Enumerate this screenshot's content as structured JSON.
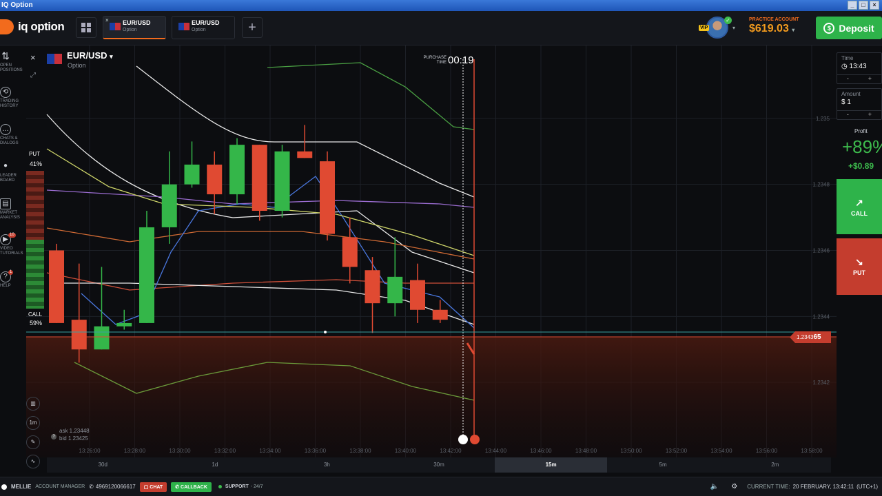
{
  "window": {
    "title": "IQ Option"
  },
  "header": {
    "logo": "iq option",
    "tabs": [
      {
        "label": "EUR/USD",
        "sub": "Option",
        "active": true
      },
      {
        "label": "EUR/USD",
        "sub": "Option",
        "active": false
      }
    ],
    "vip": "VIP",
    "account_label": "PRACTICE ACCOUNT",
    "balance": "$619.03",
    "deposit": "Deposit"
  },
  "left_rail": [
    {
      "label": "OPEN POSITIONS",
      "icon": "arrows-icon"
    },
    {
      "label": "TRADING HISTORY",
      "icon": "history-icon"
    },
    {
      "label": "CHATS & DIALOGS",
      "icon": "chat-icon"
    },
    {
      "label": "LEADER BOARD",
      "icon": "leader-icon"
    },
    {
      "label": "MARKET ANALYSIS",
      "icon": "analysis-icon"
    },
    {
      "label": "VIDEO TUTORIALS",
      "icon": "video-icon",
      "badge": "10"
    },
    {
      "label": "HELP",
      "icon": "help-icon",
      "badge": "1"
    }
  ],
  "chart": {
    "asset": "EUR/USD",
    "asset_sub": "Option",
    "purchase_label": "PURCHASE TIME",
    "purchase_time": "00:19",
    "put_label": "PUT",
    "put_pct": "41%",
    "call_label": "CALL",
    "call_pct": "59%",
    "price_tag": "1.2343",
    "price_tag_bold": "65",
    "ask": "ask 1.23448",
    "bid": "bid 1.23425",
    "y_ticks": [
      "1.235",
      "1.2348",
      "1.2346",
      "1.2344",
      "1.2342"
    ],
    "x_ticks": [
      "13:26:00",
      "13:28:00",
      "13:30:00",
      "13:32:00",
      "13:34:00",
      "13:36:00",
      "13:38:00",
      "13:40:00",
      "13:42:00",
      "13:44:00",
      "13:46:00",
      "13:48:00",
      "13:50:00",
      "13:52:00",
      "13:54:00",
      "13:56:00",
      "13:58:00"
    ],
    "bottom_icons": [
      {
        "name": "indicators-icon",
        "label": ""
      },
      {
        "name": "timeframe-button",
        "label": "1m"
      },
      {
        "name": "draw-icon",
        "label": ""
      },
      {
        "name": "chart-type-icon",
        "label": ""
      }
    ]
  },
  "right_panel": {
    "time_label": "Time",
    "time_value": "13:43",
    "amount_label": "Amount",
    "amount_value": "$ 1",
    "profit_label": "Profit",
    "profit_pct": "+89%",
    "profit_amt": "+$0.89",
    "call": "CALL",
    "put": "PUT"
  },
  "timeframes": [
    "30d",
    "1d",
    "3h",
    "30m",
    "15m",
    "5m",
    "2m"
  ],
  "active_timeframe": "15m",
  "bottombar": {
    "user": "MELLIE",
    "manager": "ACCOUNT MANAGER",
    "phone": "4969120066617",
    "chat": "CHAT",
    "callback": "CALLBACK",
    "support": "SUPPORT",
    "support_sub": "- 24/7",
    "current_time_label": "CURRENT TIME:",
    "current_time": "20 FEBRUARY, 13:42:11",
    "tz": "(UTC+1)"
  },
  "chart_data": {
    "type": "candlestick",
    "candles": [
      {
        "t": "13:25:00",
        "o": 1.2346,
        "c": 1.23438,
        "h": 1.23462,
        "l": 1.23438,
        "dir": "down"
      },
      {
        "t": "13:26:00",
        "o": 1.23439,
        "c": 1.2343,
        "h": 1.23456,
        "l": 1.23426,
        "dir": "down"
      },
      {
        "t": "13:27:00",
        "o": 1.2343,
        "c": 1.23437,
        "h": 1.23455,
        "l": 1.2343,
        "dir": "up"
      },
      {
        "t": "13:28:00",
        "o": 1.23438,
        "c": 1.23437,
        "h": 1.23442,
        "l": 1.23436,
        "dir": "up"
      },
      {
        "t": "13:29:00",
        "o": 1.23438,
        "c": 1.23467,
        "h": 1.23472,
        "l": 1.23438,
        "dir": "up"
      },
      {
        "t": "13:30:00",
        "o": 1.23467,
        "c": 1.2348,
        "h": 1.2349,
        "l": 1.23462,
        "dir": "up"
      },
      {
        "t": "13:31:00",
        "o": 1.2348,
        "c": 1.23486,
        "h": 1.23493,
        "l": 1.23479,
        "dir": "up"
      },
      {
        "t": "13:32:00",
        "o": 1.23486,
        "c": 1.23477,
        "h": 1.2349,
        "l": 1.23471,
        "dir": "down"
      },
      {
        "t": "13:33:00",
        "o": 1.23477,
        "c": 1.23492,
        "h": 1.23494,
        "l": 1.23474,
        "dir": "up"
      },
      {
        "t": "13:34:00",
        "o": 1.23492,
        "c": 1.23472,
        "h": 1.23492,
        "l": 1.23469,
        "dir": "down"
      },
      {
        "t": "13:35:00",
        "o": 1.23472,
        "c": 1.2349,
        "h": 1.23492,
        "l": 1.2347,
        "dir": "up"
      },
      {
        "t": "13:36:00",
        "o": 1.2349,
        "c": 1.23488,
        "h": 1.23498,
        "l": 1.23488,
        "dir": "down"
      },
      {
        "t": "13:37:00",
        "o": 1.23487,
        "c": 1.23465,
        "h": 1.2349,
        "l": 1.23463,
        "dir": "down"
      },
      {
        "t": "13:38:00",
        "o": 1.23464,
        "c": 1.23455,
        "h": 1.2347,
        "l": 1.2345,
        "dir": "down"
      },
      {
        "t": "13:39:00",
        "o": 1.23454,
        "c": 1.23444,
        "h": 1.23458,
        "l": 1.23435,
        "dir": "down"
      },
      {
        "t": "13:40:00",
        "o": 1.23444,
        "c": 1.23452,
        "h": 1.23464,
        "l": 1.2344,
        "dir": "up"
      },
      {
        "t": "13:41:00",
        "o": 1.23451,
        "c": 1.23442,
        "h": 1.23456,
        "l": 1.23438,
        "dir": "down"
      },
      {
        "t": "13:42:00",
        "o": 1.23442,
        "c": 1.23439,
        "h": 1.23445,
        "l": 1.23438,
        "dir": "down"
      }
    ],
    "ylim": [
      1.234,
      1.2352
    ],
    "current_price": 1.234365
  }
}
